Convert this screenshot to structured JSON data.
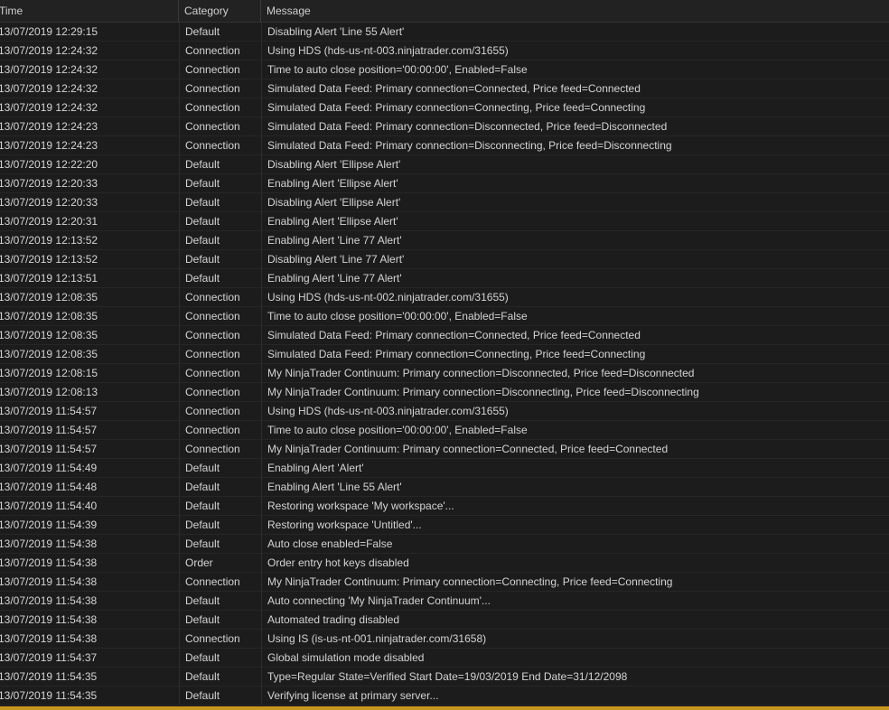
{
  "columns": {
    "time": "Time",
    "category": "Category",
    "message": "Message"
  },
  "rows": [
    {
      "time": "13/07/2019 12:29:15",
      "category": "Default",
      "message": "Disabling Alert 'Line 55 Alert'"
    },
    {
      "time": "13/07/2019 12:24:32",
      "category": "Connection",
      "message": "Using HDS (hds-us-nt-003.ninjatrader.com/31655)"
    },
    {
      "time": "13/07/2019 12:24:32",
      "category": "Connection",
      "message": "Time to auto close position='00:00:00', Enabled=False"
    },
    {
      "time": "13/07/2019 12:24:32",
      "category": "Connection",
      "message": "Simulated Data Feed: Primary connection=Connected, Price feed=Connected"
    },
    {
      "time": "13/07/2019 12:24:32",
      "category": "Connection",
      "message": "Simulated Data Feed: Primary connection=Connecting, Price feed=Connecting"
    },
    {
      "time": "13/07/2019 12:24:23",
      "category": "Connection",
      "message": "Simulated Data Feed: Primary connection=Disconnected, Price feed=Disconnected"
    },
    {
      "time": "13/07/2019 12:24:23",
      "category": "Connection",
      "message": "Simulated Data Feed: Primary connection=Disconnecting, Price feed=Disconnecting"
    },
    {
      "time": "13/07/2019 12:22:20",
      "category": "Default",
      "message": "Disabling Alert 'Ellipse Alert'"
    },
    {
      "time": "13/07/2019 12:20:33",
      "category": "Default",
      "message": "Enabling Alert 'Ellipse Alert'"
    },
    {
      "time": "13/07/2019 12:20:33",
      "category": "Default",
      "message": "Disabling Alert 'Ellipse Alert'"
    },
    {
      "time": "13/07/2019 12:20:31",
      "category": "Default",
      "message": "Enabling Alert 'Ellipse Alert'"
    },
    {
      "time": "13/07/2019 12:13:52",
      "category": "Default",
      "message": "Enabling Alert 'Line 77 Alert'"
    },
    {
      "time": "13/07/2019 12:13:52",
      "category": "Default",
      "message": "Disabling Alert 'Line 77 Alert'"
    },
    {
      "time": "13/07/2019 12:13:51",
      "category": "Default",
      "message": "Enabling Alert 'Line 77 Alert'"
    },
    {
      "time": "13/07/2019 12:08:35",
      "category": "Connection",
      "message": "Using HDS (hds-us-nt-002.ninjatrader.com/31655)"
    },
    {
      "time": "13/07/2019 12:08:35",
      "category": "Connection",
      "message": "Time to auto close position='00:00:00', Enabled=False"
    },
    {
      "time": "13/07/2019 12:08:35",
      "category": "Connection",
      "message": "Simulated Data Feed: Primary connection=Connected, Price feed=Connected"
    },
    {
      "time": "13/07/2019 12:08:35",
      "category": "Connection",
      "message": "Simulated Data Feed: Primary connection=Connecting, Price feed=Connecting"
    },
    {
      "time": "13/07/2019 12:08:15",
      "category": "Connection",
      "message": "My NinjaTrader Continuum: Primary connection=Disconnected, Price feed=Disconnected"
    },
    {
      "time": "13/07/2019 12:08:13",
      "category": "Connection",
      "message": "My NinjaTrader Continuum: Primary connection=Disconnecting, Price feed=Disconnecting"
    },
    {
      "time": "13/07/2019 11:54:57",
      "category": "Connection",
      "message": "Using HDS (hds-us-nt-003.ninjatrader.com/31655)"
    },
    {
      "time": "13/07/2019 11:54:57",
      "category": "Connection",
      "message": "Time to auto close position='00:00:00', Enabled=False"
    },
    {
      "time": "13/07/2019 11:54:57",
      "category": "Connection",
      "message": "My NinjaTrader Continuum: Primary connection=Connected, Price feed=Connected"
    },
    {
      "time": "13/07/2019 11:54:49",
      "category": "Default",
      "message": "Enabling Alert 'Alert'"
    },
    {
      "time": "13/07/2019 11:54:48",
      "category": "Default",
      "message": "Enabling Alert 'Line 55 Alert'"
    },
    {
      "time": "13/07/2019 11:54:40",
      "category": "Default",
      "message": "Restoring workspace 'My workspace'..."
    },
    {
      "time": "13/07/2019 11:54:39",
      "category": "Default",
      "message": "Restoring workspace 'Untitled'..."
    },
    {
      "time": "13/07/2019 11:54:38",
      "category": "Default",
      "message": "Auto close enabled=False"
    },
    {
      "time": "13/07/2019 11:54:38",
      "category": "Order",
      "message": "Order entry hot keys disabled"
    },
    {
      "time": "13/07/2019 11:54:38",
      "category": "Connection",
      "message": "My NinjaTrader Continuum: Primary connection=Connecting, Price feed=Connecting"
    },
    {
      "time": "13/07/2019 11:54:38",
      "category": "Default",
      "message": "Auto connecting 'My NinjaTrader Continuum'..."
    },
    {
      "time": "13/07/2019 11:54:38",
      "category": "Default",
      "message": "Automated trading disabled"
    },
    {
      "time": "13/07/2019 11:54:38",
      "category": "Connection",
      "message": "Using IS (is-us-nt-001.ninjatrader.com/31658)"
    },
    {
      "time": "13/07/2019 11:54:37",
      "category": "Default",
      "message": "Global simulation mode disabled"
    },
    {
      "time": "13/07/2019 11:54:35",
      "category": "Default",
      "message": "Type=Regular State=Verified Start Date=19/03/2019 End Date=31/12/2098"
    },
    {
      "time": "13/07/2019 11:54:35",
      "category": "Default",
      "message": "Verifying license at primary server..."
    }
  ],
  "colors": {
    "background": "#1c1c1c",
    "header": "#222222",
    "accent_bar": "#c8961e"
  }
}
